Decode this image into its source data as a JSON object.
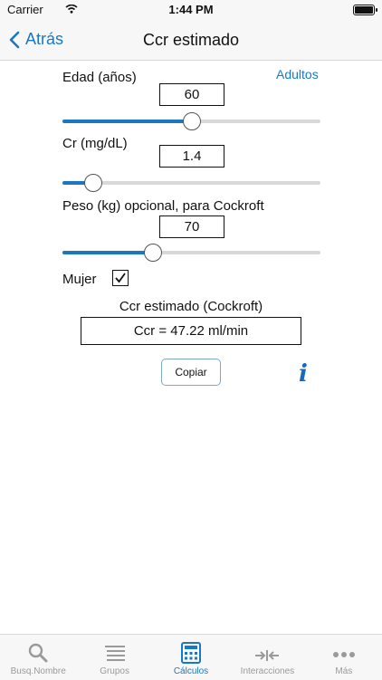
{
  "status": {
    "carrier": "Carrier",
    "time": "1:44 PM"
  },
  "nav": {
    "back_label": "Atrás",
    "title": "Ccr estimado"
  },
  "form": {
    "age_label": "Edad (años)",
    "adults_link": "Adultos",
    "age_value": "60",
    "age_slider_level": 0.5,
    "cr_label": "Cr (mg/dL)",
    "cr_value": "1.4",
    "cr_slider_level": 0.12,
    "weight_label": "Peso (kg) opcional, para Cockroft",
    "weight_value": "70",
    "weight_slider_level": 0.35,
    "female_label": "Mujer",
    "female_checked": true,
    "checkmark": "☑"
  },
  "result": {
    "title": "Ccr estimado (Cockroft)",
    "value": "Ccr = 47.22 ml/min"
  },
  "actions": {
    "copy_label": "Copiar",
    "info_glyph": "i"
  },
  "tabs": [
    {
      "label": "Busq.Nombre",
      "icon": "search-icon"
    },
    {
      "label": "Grupos",
      "icon": "list-icon"
    },
    {
      "label": "Cálculos",
      "icon": "calculator-icon",
      "active": true
    },
    {
      "label": "Interacciones",
      "icon": "arrows-icon"
    },
    {
      "label": "Más",
      "icon": "more-icon"
    }
  ],
  "colors": {
    "accent": "#1a78c2",
    "inactive": "#9a9a9a",
    "bar": "#f7f7f7"
  }
}
